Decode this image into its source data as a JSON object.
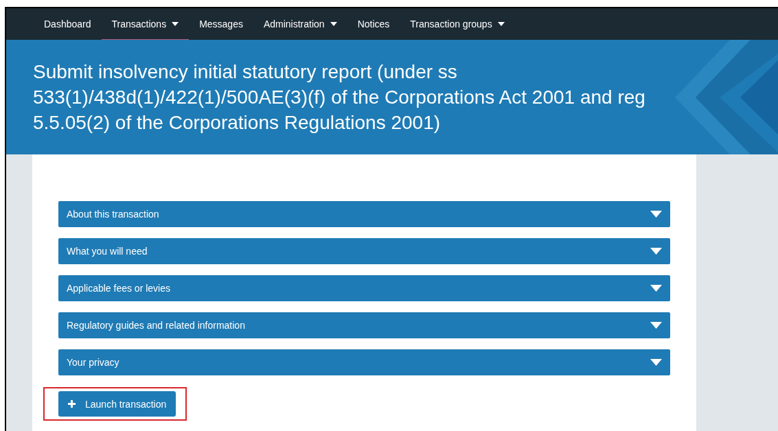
{
  "nav": {
    "items": [
      {
        "label": "Dashboard",
        "selected": false,
        "dropdown": false
      },
      {
        "label": "Transactions",
        "selected": true,
        "dropdown": true
      },
      {
        "label": "Messages",
        "selected": false,
        "dropdown": false
      },
      {
        "label": "Administration",
        "selected": false,
        "dropdown": true
      },
      {
        "label": "Notices",
        "selected": false,
        "dropdown": false
      },
      {
        "label": "Transaction groups",
        "selected": false,
        "dropdown": true
      }
    ]
  },
  "page_title": "Submit insolvency initial statutory report (under ss 533(1)/438d(1)/422(1)/500AE(3)(f) of the Corporations Act 2001 and reg 5.5.05(2) of the Corporations Regulations 2001)",
  "sections": [
    {
      "label": "About this transaction",
      "expanded": false
    },
    {
      "label": "What you will need",
      "expanded": false
    },
    {
      "label": "Applicable fees or levies",
      "expanded": false
    },
    {
      "label": "Regulatory guides and related information",
      "expanded": false
    },
    {
      "label": "Your privacy",
      "expanded": false
    }
  ],
  "launch_button": {
    "label": "Launch transaction",
    "highlighted": true
  }
}
